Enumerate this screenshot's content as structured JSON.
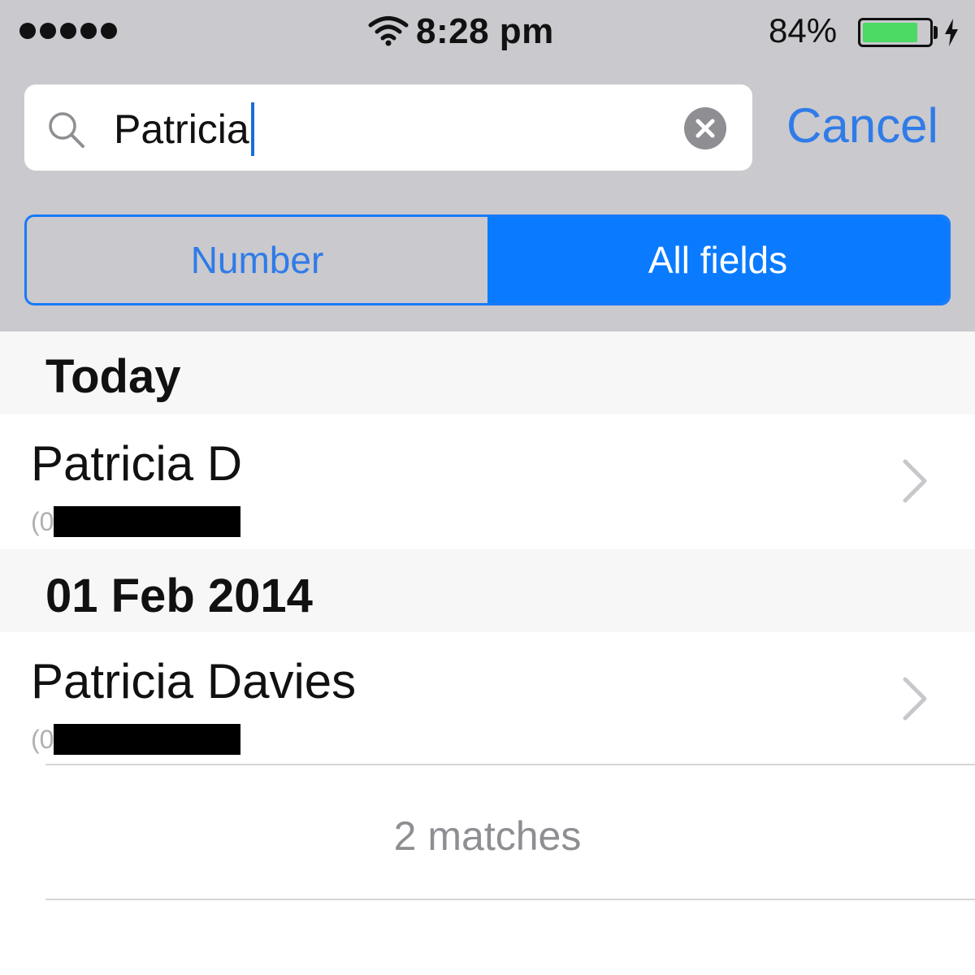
{
  "status_bar": {
    "signal_bars": 5,
    "time": "8:28 pm",
    "battery_percent": "84%",
    "battery_level": 0.84,
    "battery_color": "#4cd964",
    "charging": true
  },
  "search": {
    "query": "Patricia",
    "cancel_label": "Cancel",
    "clear_icon": "clear-circle-icon",
    "search_icon": "magnifier-icon"
  },
  "segments": {
    "items": [
      {
        "label": "Number",
        "selected": false
      },
      {
        "label": "All fields",
        "selected": true
      }
    ],
    "accent_color": "#0a7bff"
  },
  "results": {
    "sections": [
      {
        "title": "Today",
        "rows": [
          {
            "name": "Patricia D",
            "number_prefix": "(0"
          }
        ]
      },
      {
        "title": "01 Feb 2014",
        "rows": [
          {
            "name": "Patricia Davies",
            "number_prefix": "(0"
          }
        ]
      }
    ],
    "matches_label": "2 matches"
  }
}
